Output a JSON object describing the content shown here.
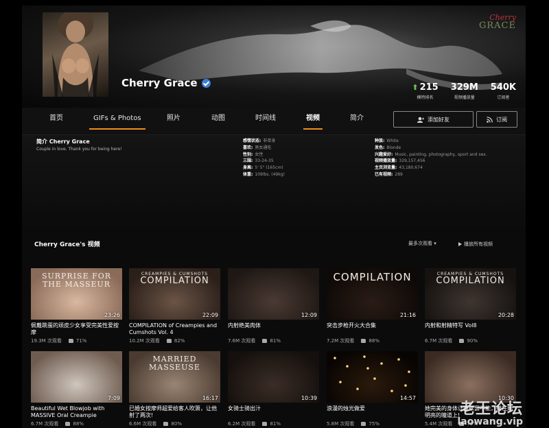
{
  "cover": {
    "logo_script": "Cherry",
    "logo_word": "GRACE"
  },
  "profile": {
    "name": "Cherry Grace"
  },
  "stats": [
    {
      "value": "215",
      "label": "模特排名"
    },
    {
      "value": "329M",
      "label": "视频播放量"
    },
    {
      "value": "540K",
      "label": "订阅者"
    }
  ],
  "nav": {
    "tabs": [
      "首页",
      "GIFs & Photos",
      "照片",
      "动图",
      "时间线",
      "视频",
      "简介"
    ],
    "active_tab": "视频",
    "add_friend": "添加好友",
    "subscribe": "订阅"
  },
  "about": {
    "title": "简介 Cherry Grace",
    "bio": "Couple in love. Thank you for being here!",
    "col1": [
      {
        "k": "感情状态:",
        "v": "非单身"
      },
      {
        "k": "喜欢:",
        "v": "男女通吃"
      },
      {
        "k": "性别:",
        "v": "女性"
      },
      {
        "k": "三围:",
        "v": "33-24-35"
      },
      {
        "k": "身高:",
        "v": "5' 5\" (165cm)"
      },
      {
        "k": "体重:",
        "v": "109lbs. (49kg)"
      }
    ],
    "col2": [
      {
        "k": "种族:",
        "v": "White"
      },
      {
        "k": "发色:",
        "v": "Blonde"
      },
      {
        "k": "兴趣爱好:",
        "v": "Music, painting, photography, sport and sex."
      },
      {
        "k": "视频播放量:",
        "v": "329,157,456"
      },
      {
        "k": "主页浏览量:",
        "v": "43,180,674"
      },
      {
        "k": "已有视频:",
        "v": "289"
      }
    ]
  },
  "videos": {
    "section_title": "Cherry Grace's 视频",
    "sort_label": "最多次观看",
    "play_all": "播放所有视频",
    "items": [
      {
        "overlay": [
          "SURPRISE FOR",
          "THE MASSEUR"
        ],
        "duration": "23:26",
        "title": "佩戴跳蛋的顽皮少女享受完美性爱按摩",
        "views": "19.3M 次观看",
        "rating": "71%"
      },
      {
        "overlay": [
          "CREAMPIES & CUMSHOTS",
          "COMPILATION"
        ],
        "duration": "22:09",
        "title": "COMPILATION of Creampies and Cumshots Vol. 4",
        "views": "10.2M 次观看",
        "rating": "82%"
      },
      {
        "overlay": [],
        "duration": "12:09",
        "title": "内射绝美肉体",
        "views": "7.6M 次观看",
        "rating": "81%"
      },
      {
        "overlay": [
          "COMPILATION"
        ],
        "duration": "21:16",
        "title": "突击步枪开火大合集",
        "views": "7.2M 次观看",
        "rating": "88%"
      },
      {
        "overlay": [
          "CREAMPIES & CUMSHOTS",
          "COMPILATION"
        ],
        "duration": "20:28",
        "title": "内射和射精特写 Vol8",
        "views": "6.7M 次观看",
        "rating": "90%"
      },
      {
        "overlay": [],
        "duration": "7:09",
        "title": "Beautiful Wet Blowjob with MASSIVE Oral Creampie",
        "views": "6.7M 次观看",
        "rating": "88%"
      },
      {
        "overlay": [
          "MARRIED MASSEUSE"
        ],
        "duration": "16:17",
        "title": "已婚女按摩师超爱给客人吹箫，让他射了两次!",
        "views": "6.6M 次观看",
        "rating": "80%"
      },
      {
        "overlay": [],
        "duration": "10:39",
        "title": "女骑士骑出汁",
        "views": "6.2M 次观看",
        "rating": "81%"
      },
      {
        "overlay": [],
        "duration": "14:57",
        "title": "浪漫的烛光做爱",
        "views": "5.8M 次观看",
        "rating": "75%"
      },
      {
        "overlay": [],
        "duration": "10:30",
        "title": "她完美的身体让我欲罢不能，射在她明亮的瞳道上!",
        "views": "5.4M 次观看",
        "rating": "79%"
      }
    ]
  },
  "watermark": {
    "cn": "老王论坛",
    "url": "laowang.vip"
  }
}
